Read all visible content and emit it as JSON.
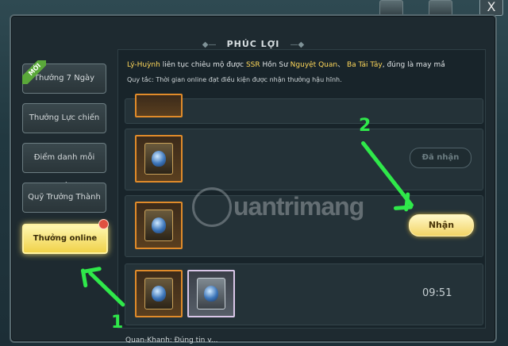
{
  "window": {
    "title": "PHÚC LỢI",
    "close_label": "X"
  },
  "sidebar": {
    "new_badge": "MỚI",
    "items": [
      {
        "label": "Thưởng 7 Ngày"
      },
      {
        "label": "Thưởng Lực chiến"
      },
      {
        "label": "Điểm danh mỗi ngày"
      },
      {
        "label": "Quỹ Trưởng Thành"
      },
      {
        "label": "Thưởng online"
      }
    ]
  },
  "announcement": {
    "player": "Lý-Huỳnh",
    "text1": "liên tục chiêu mộ được",
    "rarity": "SSR",
    "text2": "Hồn Sư",
    "hero1": "Nguyệt Quan",
    "sep": "、",
    "hero2": "Ba Tái Tây",
    "text3": ", đúng là may mắ"
  },
  "rule_text": "Quy tắc: Thời gian online đạt điều kiện được nhận thưởng hậu hĩnh.",
  "rows": {
    "done_label": "Đã nhận",
    "claim_label": "Nhận",
    "timer": "09:51"
  },
  "annotations": {
    "step1": "1",
    "step2": "2"
  },
  "watermark": "uantrimang",
  "footer_text": "Quan-Khanh: Đúng tin v...",
  "colors": {
    "accent_yellow": "#ffd85a",
    "arrow_green": "#2fe84a",
    "item_border_gold": "#e08b2a"
  }
}
